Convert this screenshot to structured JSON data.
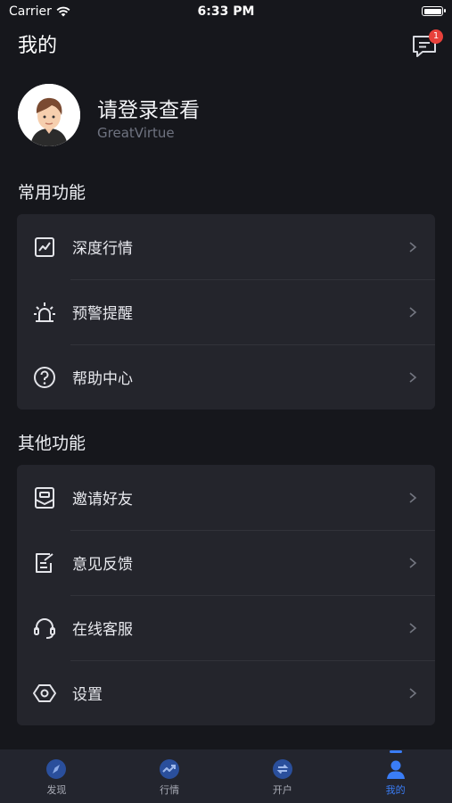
{
  "status_bar": {
    "carrier": "Carrier",
    "time": "6:33 PM"
  },
  "header": {
    "title": "我的",
    "message_badge": "1"
  },
  "profile": {
    "name": "请登录查看",
    "subtitle": "GreatVirtue"
  },
  "sections": {
    "common": {
      "title": "常用功能",
      "items": [
        {
          "label": "深度行情",
          "icon": "chart-line-icon"
        },
        {
          "label": "预警提醒",
          "icon": "alarm-light-icon"
        },
        {
          "label": "帮助中心",
          "icon": "help-circle-icon"
        }
      ]
    },
    "other": {
      "title": "其他功能",
      "items": [
        {
          "label": "邀请好友",
          "icon": "invite-icon"
        },
        {
          "label": "意见反馈",
          "icon": "feedback-icon"
        },
        {
          "label": "在线客服",
          "icon": "headset-icon"
        },
        {
          "label": "设置",
          "icon": "settings-icon"
        }
      ]
    }
  },
  "tabbar": {
    "tabs": [
      {
        "label": "发现",
        "icon": "compass-icon"
      },
      {
        "label": "行情",
        "icon": "trend-icon"
      },
      {
        "label": "开户",
        "icon": "exchange-icon"
      },
      {
        "label": "我的",
        "icon": "user-icon"
      }
    ],
    "active": "我的"
  },
  "colors": {
    "accent": "#3a7df6",
    "background": "#16171c",
    "card": "#24252c",
    "badge": "#e8413b"
  }
}
